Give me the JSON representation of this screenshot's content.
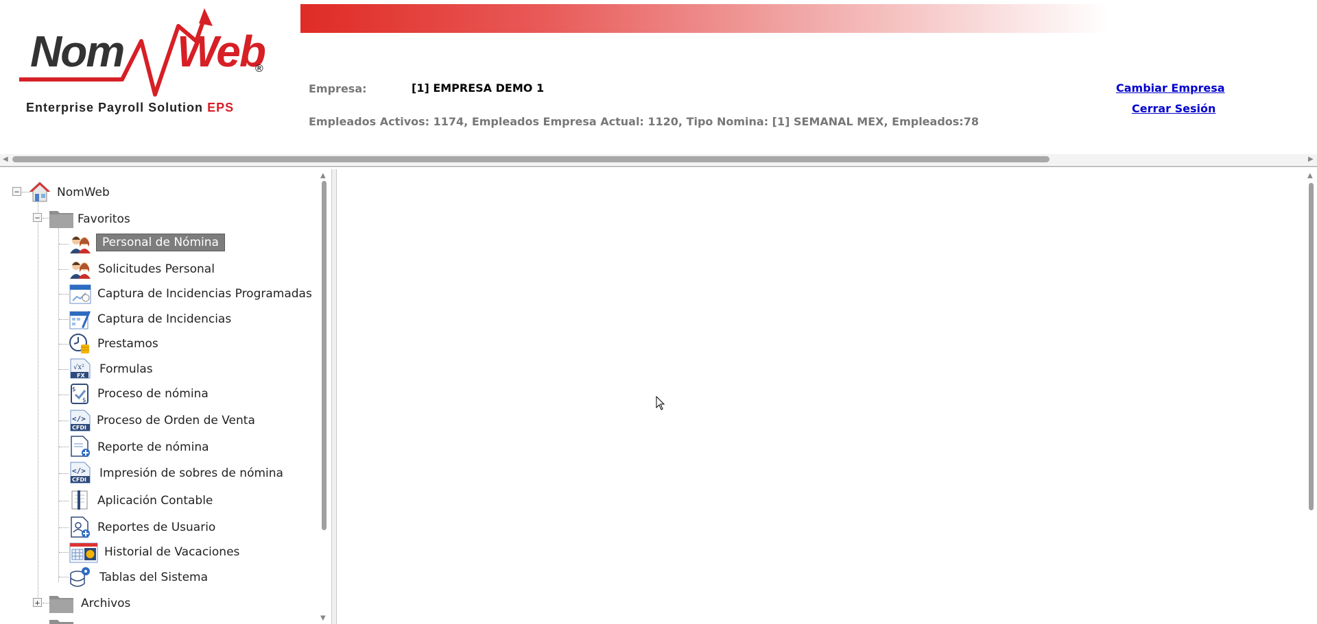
{
  "header": {
    "logo_nom": "Nom",
    "logo_web": "Web",
    "logo_reg": "®",
    "logo_sub_main": "Enterprise Payroll Solution",
    "logo_sub_eps": "EPS",
    "empresa_label": "Empresa:",
    "empresa_value": "[1] EMPRESA DEMO 1",
    "info_line": "Empleados Activos: 1174, Empleados Empresa Actual: 1120, Tipo Nomina: [1] SEMANAL MEX, Empleados:78",
    "cambiar_empresa": "Cambiar Empresa",
    "cerrar_sesion": "Cerrar Sesión",
    "accent_color": "#d71f26"
  },
  "tree": {
    "root": {
      "label": "NomWeb",
      "icon": "home-icon",
      "expander": "−"
    },
    "favoritos": {
      "label": "Favoritos",
      "icon": "folder-icon",
      "expander": "−"
    },
    "items": [
      {
        "label": "Personal de Nómina",
        "icon": "people-icon",
        "selected": true
      },
      {
        "label": "Solicitudes Personal",
        "icon": "people-icon"
      },
      {
        "label": "Captura de Incidencias Programadas",
        "icon": "calendar-chart-icon"
      },
      {
        "label": "Captura de Incidencias",
        "icon": "calendar-edit-icon"
      },
      {
        "label": "Prestamos",
        "icon": "clock-coins-icon"
      },
      {
        "label": "Formulas",
        "icon": "formula-icon"
      },
      {
        "label": "Proceso de nómina",
        "icon": "payroll-process-icon"
      },
      {
        "label": "Proceso de Orden de Venta",
        "icon": "cfdi-icon"
      },
      {
        "label": "Reporte de nómina",
        "icon": "report-add-icon"
      },
      {
        "label": "Impresión de sobres de nómina",
        "icon": "cfdi-icon"
      },
      {
        "label": "Aplicación Contable",
        "icon": "ledger-icon"
      },
      {
        "label": "Reportes de Usuario",
        "icon": "user-report-icon"
      },
      {
        "label": "Historial de Vacaciones",
        "icon": "vacation-calendar-icon"
      },
      {
        "label": "Tablas del Sistema",
        "icon": "database-gear-icon"
      }
    ],
    "archivos": {
      "label": "Archivos",
      "icon": "folder-icon",
      "expander": "+"
    }
  },
  "scroll_arrows": {
    "left": "◀",
    "right": "▶",
    "up": "▲",
    "down": "▼"
  }
}
